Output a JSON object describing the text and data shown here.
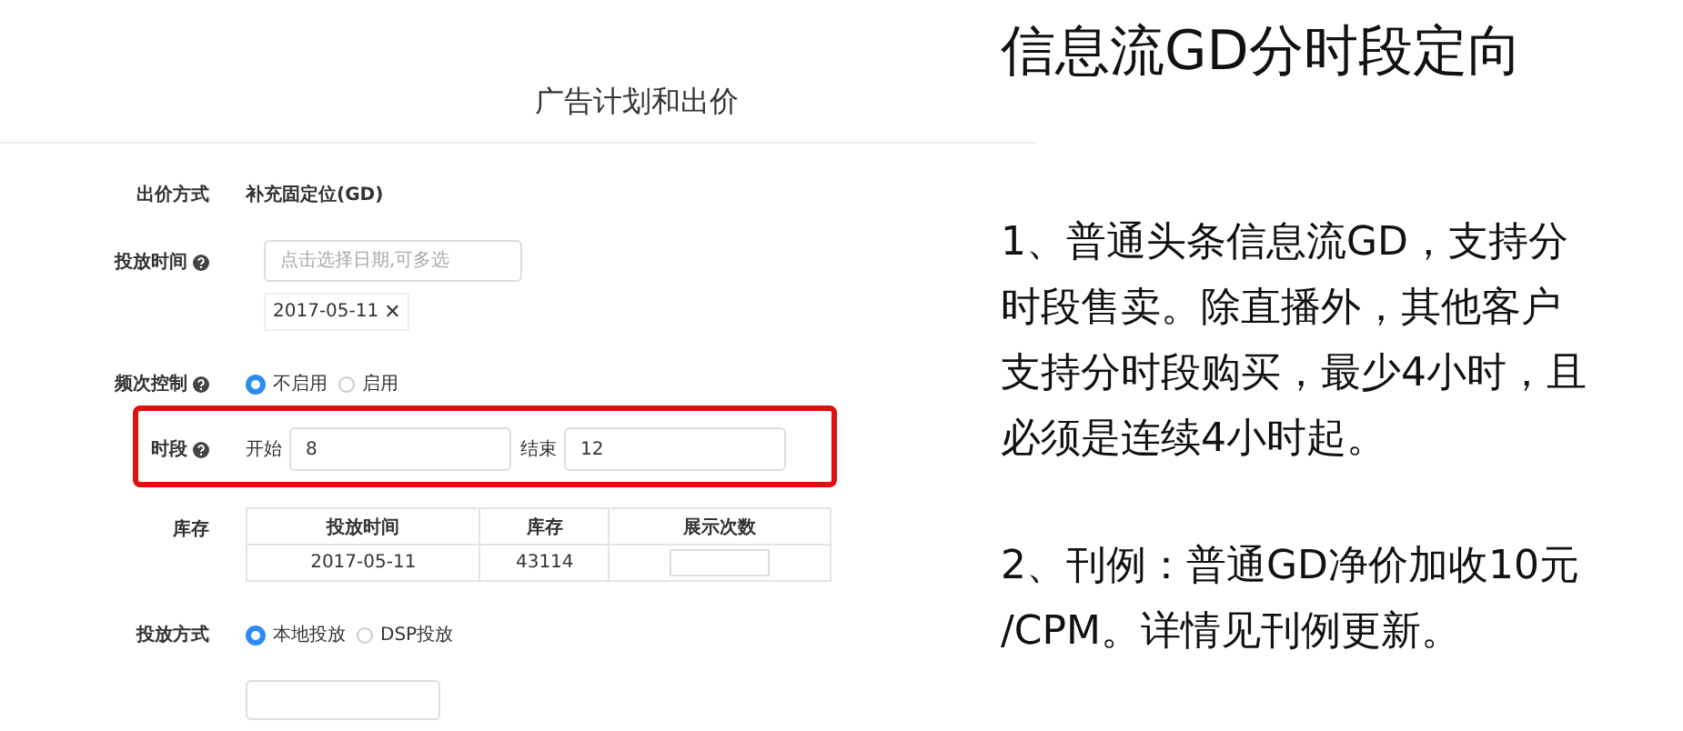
{
  "screenshot": {
    "heading": "广告计划和出价",
    "rows": [
      {
        "kind": "text",
        "label": "出价方式",
        "help": false,
        "value": "补充固定位(GD)"
      },
      {
        "kind": "date",
        "label": "投放时间",
        "help": true,
        "placeholder": "点击选择日期,可多选",
        "tags": [
          {
            "text": "2017-05-11",
            "remove": "✕"
          }
        ]
      },
      {
        "kind": "radio",
        "label": "频次控制",
        "help": true,
        "options": [
          {
            "label": "不启用",
            "selected": true
          },
          {
            "label": "启用",
            "selected": false
          }
        ]
      },
      {
        "kind": "range",
        "label": "时段",
        "help": true,
        "highlighted": true,
        "start_label": "开始",
        "start": "8",
        "end_label": "结束",
        "end": "12"
      },
      {
        "kind": "table",
        "label": "库存",
        "help": false,
        "columns": [
          "投放时间",
          "库存",
          "展示次数"
        ],
        "rows": [
          [
            "2017-05-11",
            "43114",
            ""
          ]
        ]
      },
      {
        "kind": "radio",
        "label": "投放方式",
        "help": false,
        "options": [
          {
            "label": "本地投放",
            "selected": true
          },
          {
            "label": "DSP投放",
            "selected": false
          }
        ]
      },
      {
        "kind": "cutoff"
      }
    ]
  },
  "notes": {
    "title": "信息流GD分时段定向",
    "paragraphs": [
      "1、普通头条信息流GD，支持分时段售卖。除直播外，其他客户支持分时段购买，最少4小时，且必须是连续4小时起。",
      "2、刊例：普通GD净价加收10元/CPM。详情见刊例更新。"
    ]
  }
}
